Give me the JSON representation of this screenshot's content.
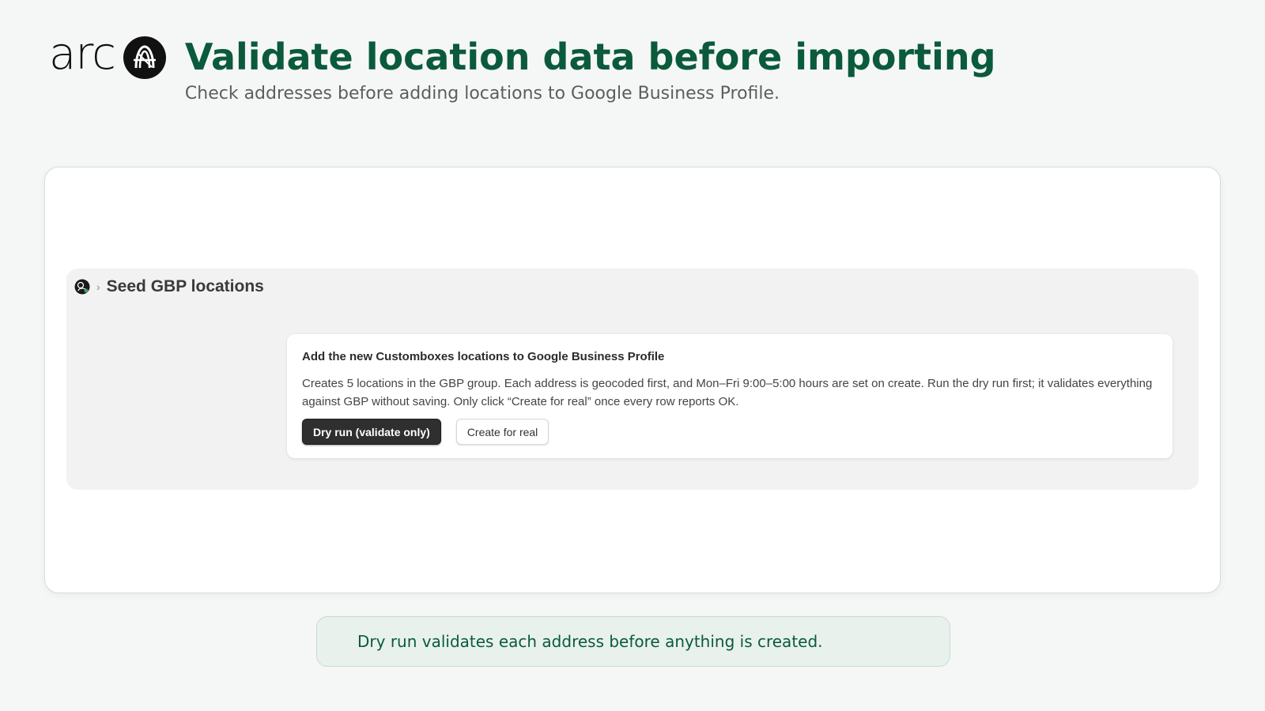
{
  "brand": {
    "wordmark": "arc",
    "mark_icon": "arc-mark-icon"
  },
  "header": {
    "title": "Validate location data before importing",
    "subtitle": "Check addresses before adding locations to Google Business Profile."
  },
  "app": {
    "breadcrumb": {
      "avatar_icon": "workspace-avatar-icon",
      "separator": "›",
      "title": "Seed GBP locations"
    },
    "card": {
      "title": "Add the new Customboxes locations to Google Business Profile",
      "description": "Creates 5 locations in the GBP group. Each address is geocoded first, and Mon–Fri 9:00–5:00 hours are set on create. Run the dry run first; it validates everything against GBP without saving. Only click “Create for real” once every row reports OK.",
      "primary_button": "Dry run (validate only)",
      "secondary_button": "Create for real"
    }
  },
  "note": {
    "text": "Dry run validates each address before anything is created."
  },
  "colors": {
    "title_green": "#0b5a3c",
    "page_bg": "#f5f7f6",
    "note_bg": "#e8f1ec",
    "primary_button_bg": "#2f2f2f"
  }
}
